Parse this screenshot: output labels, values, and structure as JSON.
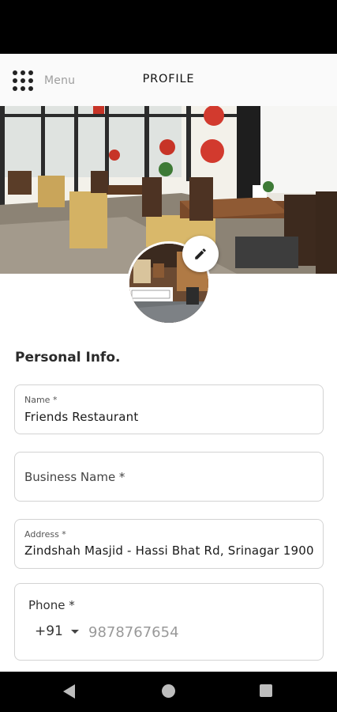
{
  "header": {
    "menu_label": "Menu",
    "title": "PROFILE"
  },
  "icons": {
    "menu": "grid-dots-icon",
    "edit": "pencil-icon",
    "back": "back-triangle-icon",
    "home": "home-circle-icon",
    "recents": "recents-square-icon"
  },
  "personal_info": {
    "section_title": "Personal Info.",
    "name": {
      "label": "Name *",
      "value": "Friends Restaurant"
    },
    "business_name": {
      "placeholder": "Business Name *"
    },
    "address": {
      "label": "Address *",
      "value": "Zindshah Masjid - Hassi Bhat Rd, Srinagar 1900"
    },
    "phone": {
      "label": "Phone *",
      "country_code": "+91",
      "placeholder": "9878767654"
    }
  },
  "colors": {
    "header_bg": "#fafafa",
    "text_primary": "#1a1a1a",
    "border": "#d3d3d3",
    "system_bar": "#000000"
  }
}
